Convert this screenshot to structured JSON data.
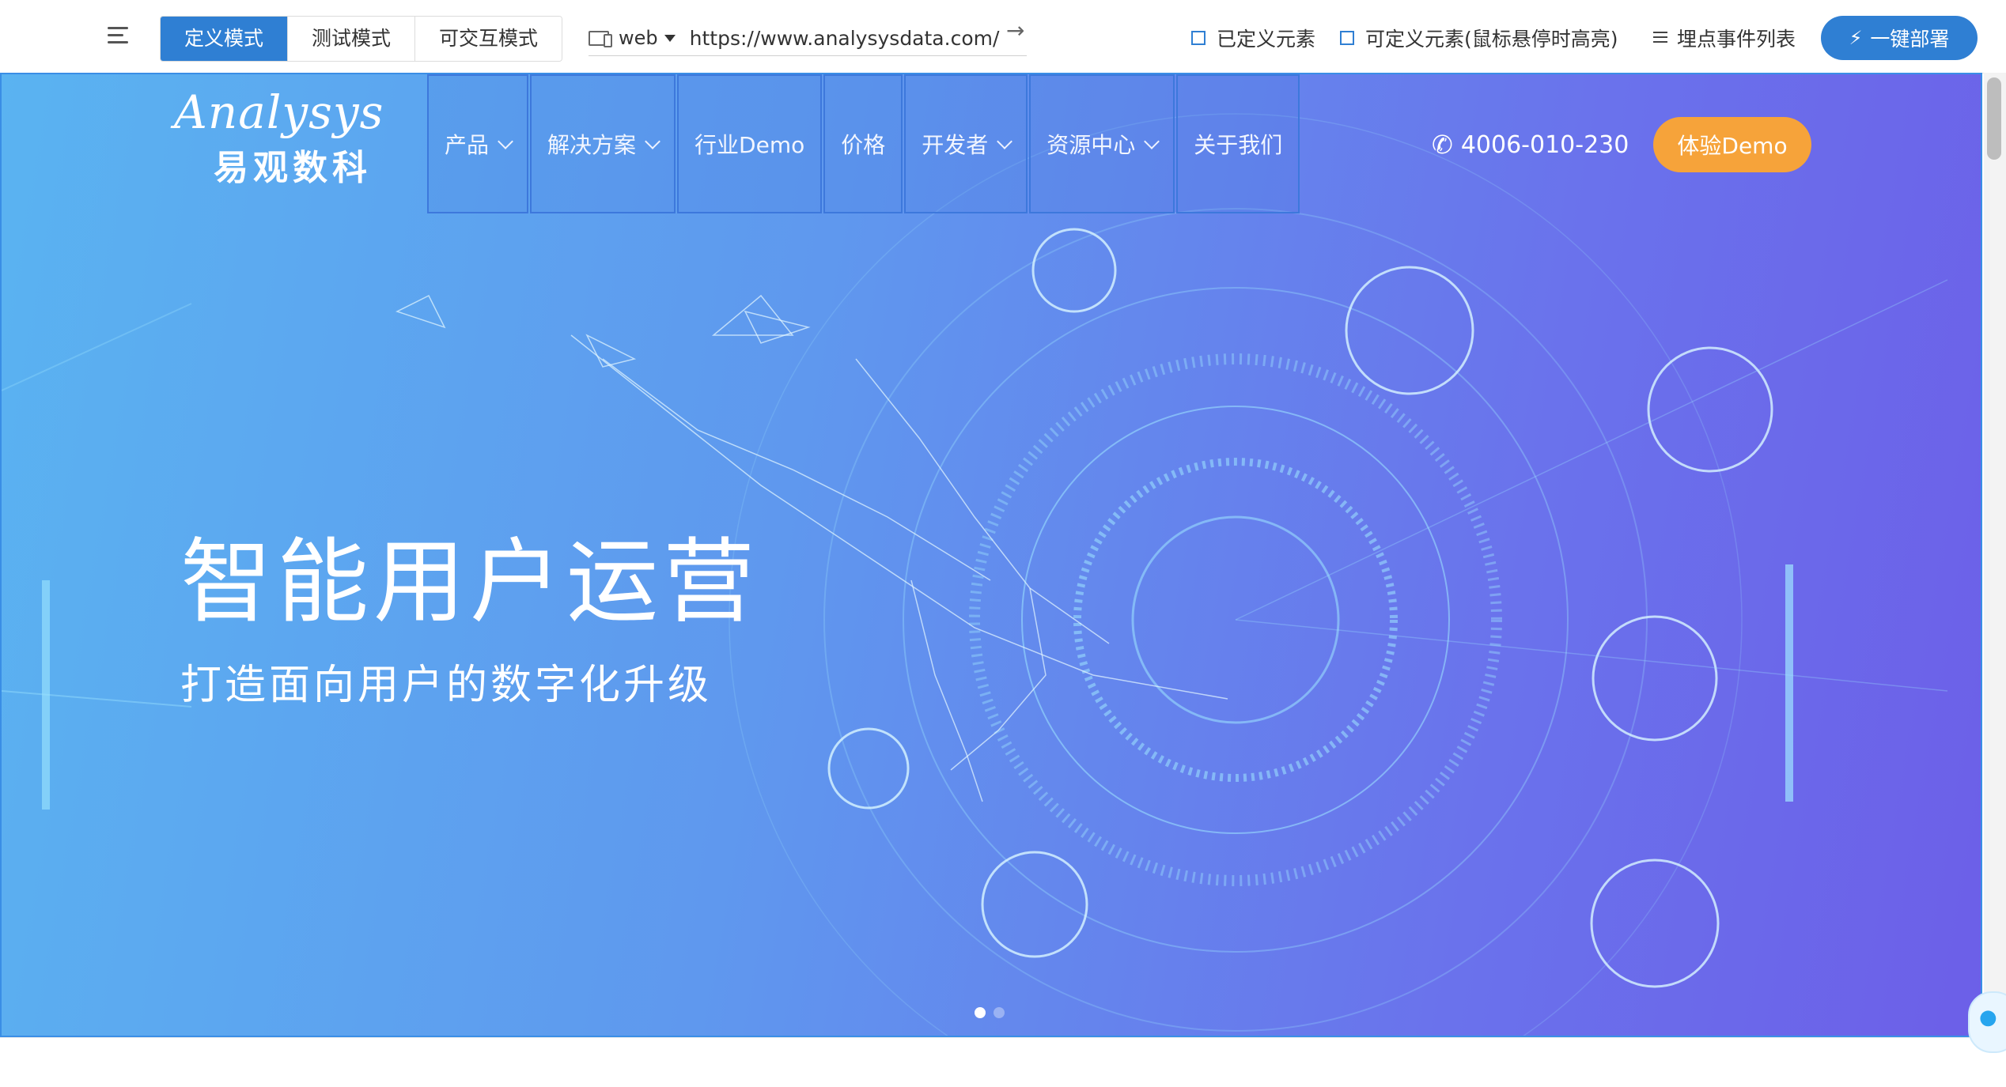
{
  "toolbar": {
    "modes": [
      "定义模式",
      "测试模式",
      "可交互模式"
    ],
    "active_mode": "定义模式",
    "platform": "web",
    "url": "https://www.analysysdata.com/",
    "legend_defined": "已定义元素",
    "legend_definable": "可定义元素(鼠标悬停时高亮)",
    "event_list": "埋点事件列表",
    "deploy": "一键部署",
    "accent_color": "#2f7fd3"
  },
  "site": {
    "logo_en_main": "nalysys",
    "logo_en_a": "A",
    "logo_cn": "易观数科",
    "nav": [
      "产品",
      "解决方案",
      "行业Demo",
      "价格",
      "开发者",
      "资源中心",
      "关于我们"
    ],
    "phone": "4006-010-230",
    "demo_button": "体验Demo",
    "headline": "智能用户运营",
    "subheadline": "打造面向用户的数字化升级",
    "carousel_dots": 2,
    "active_dot": 1,
    "demo_button_color": "#f6a33a"
  },
  "icons": [
    "menu-icon",
    "device-icon",
    "caret-down-icon",
    "arrow-right-icon",
    "list-icon",
    "bolt-icon",
    "phone-icon",
    "chevron-down-icon",
    "chat-icon"
  ]
}
